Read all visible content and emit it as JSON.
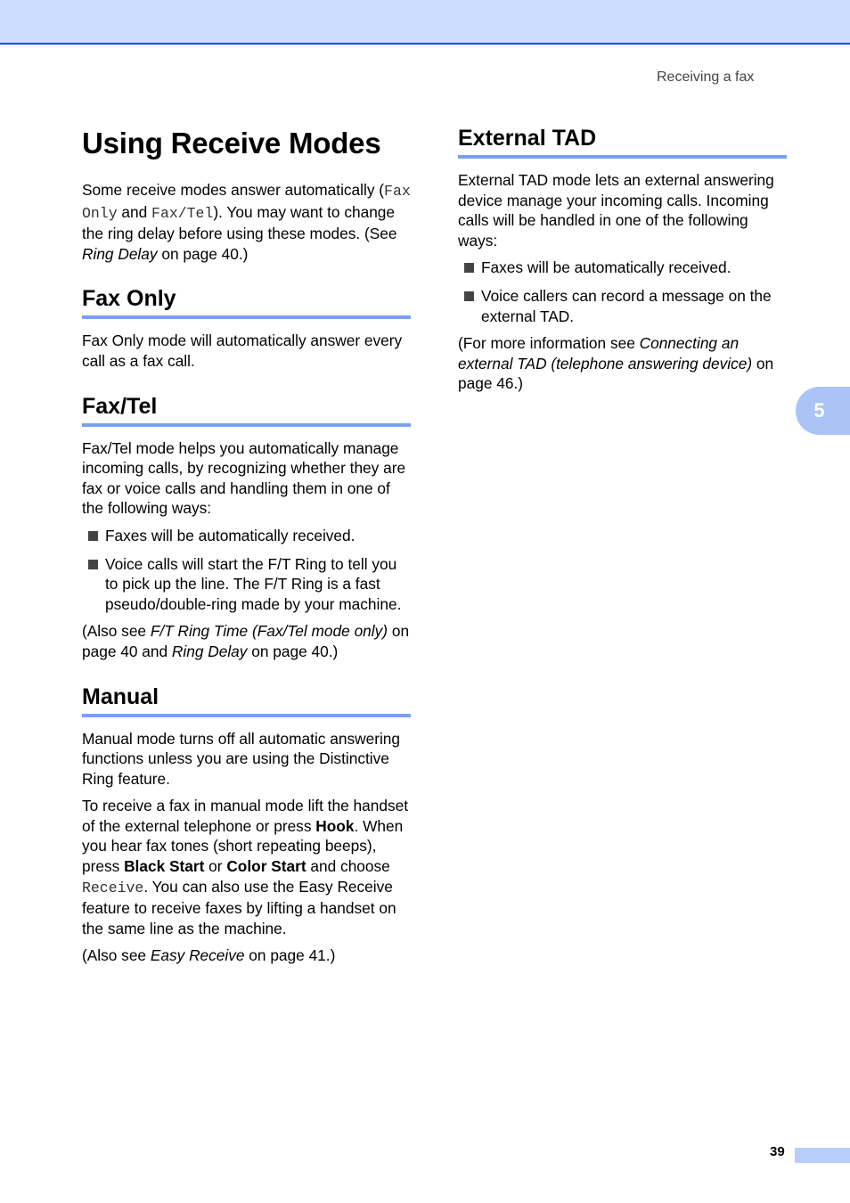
{
  "header": {
    "running_head": "Receiving a fax"
  },
  "chapter_tab": "5",
  "footer": {
    "page_number": "39"
  },
  "left": {
    "title": "Using Receive Modes",
    "intro": {
      "t1": "Some receive modes answer automatically (",
      "m1": "Fax Only",
      "t2": " and ",
      "m2": "Fax/Tel",
      "t3": "). You may want to change the ring delay before using these modes. (See ",
      "i1": "Ring Delay",
      "t4": " on page 40.)"
    },
    "fax_only": {
      "heading": "Fax Only",
      "body": "Fax Only mode will automatically answer every call as a fax call."
    },
    "fax_tel": {
      "heading": "Fax/Tel",
      "body": "Fax/Tel mode helps you automatically manage incoming calls, by recognizing whether they are fax or voice calls and handling them in one of the following ways:",
      "bullets": [
        "Faxes will be automatically received.",
        "Voice calls will start the F/T Ring to tell you to pick up the line. The F/T Ring is a fast pseudo/double-ring made by your machine."
      ],
      "see_also": {
        "t1": "(Also see ",
        "i1": "F/T Ring Time (Fax/Tel mode only)",
        "t2": " on page 40 and ",
        "i2": "Ring Delay",
        "t3": " on page 40.)"
      }
    },
    "manual": {
      "heading": "Manual",
      "body1": "Manual mode turns off all automatic answering functions unless you are using the Distinctive Ring feature.",
      "body2": {
        "t1": "To receive a fax in manual mode lift the handset of the external telephone or press ",
        "b1": "Hook",
        "t2": ". When you hear fax tones (short repeating beeps), press ",
        "b2": "Black Start",
        "t3": " or ",
        "b3": "Color Start",
        "t4": " and choose ",
        "m1": "Receive",
        "t5": ". You can also use the Easy Receive feature to receive faxes by lifting a handset on the same line as the machine."
      },
      "see_also": {
        "t1": "(Also see ",
        "i1": "Easy Receive",
        "t2": " on page 41.)"
      }
    }
  },
  "right": {
    "external_tad": {
      "heading": "External TAD",
      "body": "External TAD mode lets an external answering device manage your incoming calls. Incoming calls will be handled in one of the following ways:",
      "bullets": [
        "Faxes will be automatically received.",
        "Voice callers can record a message on the external TAD."
      ],
      "see_also": {
        "t1": "(For more information see ",
        "i1": "Connecting an external TAD (telephone answering device)",
        "t2": " on page 46.)"
      }
    }
  }
}
